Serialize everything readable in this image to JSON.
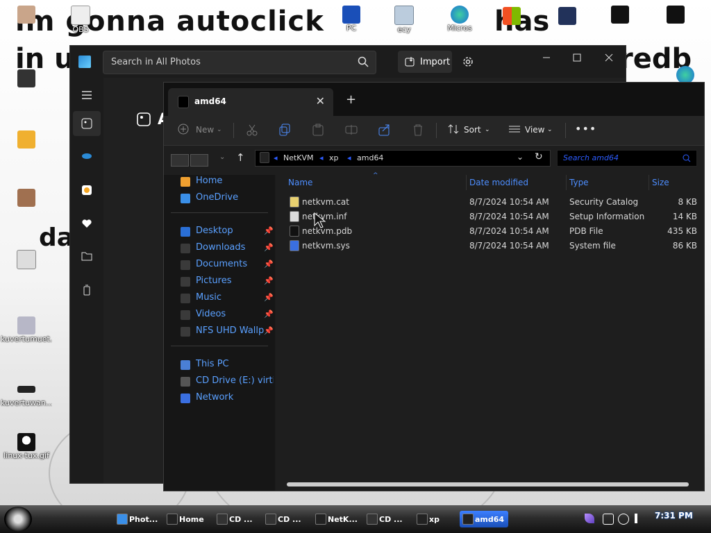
{
  "wallpaper": {
    "text_1": "im gonna autoclick",
    "text_2": "in u",
    "text_3": "redb",
    "text_4": "da",
    "text_5": "has"
  },
  "desktop_icons": [
    {
      "label": ""
    },
    {
      "label": "OBS"
    },
    {
      "label": "PC"
    },
    {
      "label": "ecy"
    },
    {
      "label": "Micros"
    },
    {
      "label": "kuvertumuet..."
    },
    {
      "label": "kuvertuwan..."
    },
    {
      "label": "linux-tux.gif"
    }
  ],
  "photos": {
    "search_placeholder": "Search in All Photos",
    "import_label": "Import",
    "heading": "A"
  },
  "explorer": {
    "tab_title": "amd64",
    "toolbar": {
      "new": "New",
      "sort": "Sort",
      "view": "View"
    },
    "breadcrumb": [
      "NetKVM",
      "xp",
      "amd64"
    ],
    "search_placeholder": "Search amd64",
    "sidebar": {
      "quick": [
        {
          "label": "Home",
          "color": "#f0a030"
        },
        {
          "label": "OneDrive",
          "color": "#3a8fe8"
        }
      ],
      "pinned": [
        {
          "label": "Desktop",
          "color": "#2a6fd6"
        },
        {
          "label": "Downloads",
          "color": "#3a3a3a"
        },
        {
          "label": "Documents",
          "color": "#3a3a3a"
        },
        {
          "label": "Pictures",
          "color": "#3a3a3a"
        },
        {
          "label": "Music",
          "color": "#3a3a3a"
        },
        {
          "label": "Videos",
          "color": "#3a3a3a"
        },
        {
          "label": "NFS UHD Wallpapers",
          "color": "#3a3a3a"
        }
      ],
      "devices": [
        {
          "label": "This PC",
          "color": "#4a7fd6"
        },
        {
          "label": "CD Drive (E:) virtio-win",
          "color": "#555"
        },
        {
          "label": "Network",
          "color": "#3a6fe0"
        }
      ]
    },
    "columns": [
      "Name",
      "Date modified",
      "Type",
      "Size"
    ],
    "files": [
      {
        "name": "netkvm.cat",
        "date": "8/7/2024 10:54 AM",
        "type": "Security Catalog",
        "size": "8 KB",
        "icon_color": "#e8d070"
      },
      {
        "name": "netkvm.inf",
        "date": "8/7/2024 10:54 AM",
        "type": "Setup Information",
        "size": "14 KB",
        "icon_color": "#dcdcdc"
      },
      {
        "name": "netkvm.pdb",
        "date": "8/7/2024 10:54 AM",
        "type": "PDB File",
        "size": "435 KB",
        "icon_color": "#111111"
      },
      {
        "name": "netkvm.sys",
        "date": "8/7/2024 10:54 AM",
        "type": "System file",
        "size": "86 KB",
        "icon_color": "#3a6fe0"
      }
    ]
  },
  "taskbar": {
    "buttons": [
      {
        "label": "Phot...",
        "color": "#3a8fe8"
      },
      {
        "label": "Home",
        "color": "#222"
      },
      {
        "label": "CD ...",
        "color": "#333"
      },
      {
        "label": "CD ...",
        "color": "#333"
      },
      {
        "label": "NetK...",
        "color": "#222"
      },
      {
        "label": "CD ...",
        "color": "#333"
      },
      {
        "label": "xp",
        "color": "#222"
      },
      {
        "label": "amd64",
        "color": "#222"
      }
    ],
    "clock": "7:31 PM"
  }
}
